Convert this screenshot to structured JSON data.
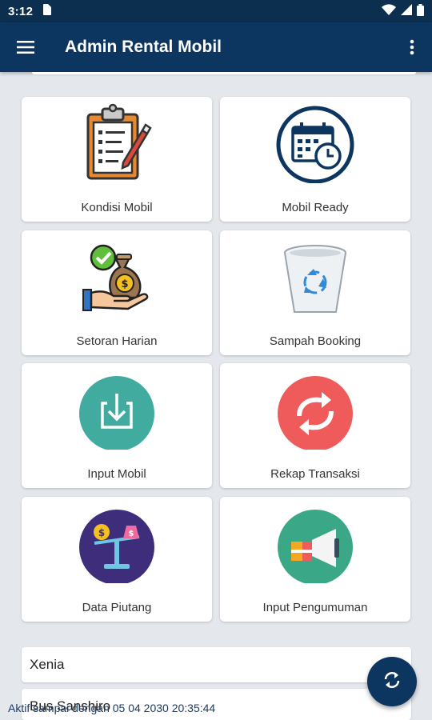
{
  "status_bar": {
    "time": "3:12"
  },
  "app_bar": {
    "title": "Admin Rental Mobil"
  },
  "menu": [
    {
      "label": "Kondisi Mobil",
      "icon": "clipboard-checklist-icon"
    },
    {
      "label": "Mobil Ready",
      "icon": "calendar-clock-icon"
    },
    {
      "label": "Setoran Harian",
      "icon": "money-bag-hand-icon"
    },
    {
      "label": "Sampah Booking",
      "icon": "recycle-bin-icon"
    },
    {
      "label": "Input Mobil",
      "icon": "download-box-icon"
    },
    {
      "label": "Rekap Transaksi",
      "icon": "sync-arrows-icon"
    },
    {
      "label": "Data Piutang",
      "icon": "balance-scale-icon"
    },
    {
      "label": "Input Pengumuman",
      "icon": "megaphone-icon"
    }
  ],
  "list": [
    {
      "text": "Xenia"
    },
    {
      "text": "Bus Sanshiro"
    }
  ],
  "footer": {
    "text": "Aktif sampai dengan 05 04 2030 20:35:44"
  },
  "colors": {
    "app_bar": "#0c3660",
    "status_bar": "#0c2e4f",
    "teal": "#3fada0",
    "red": "#ef5b5b",
    "purple": "#3e2d7a",
    "green": "#3aa886"
  }
}
